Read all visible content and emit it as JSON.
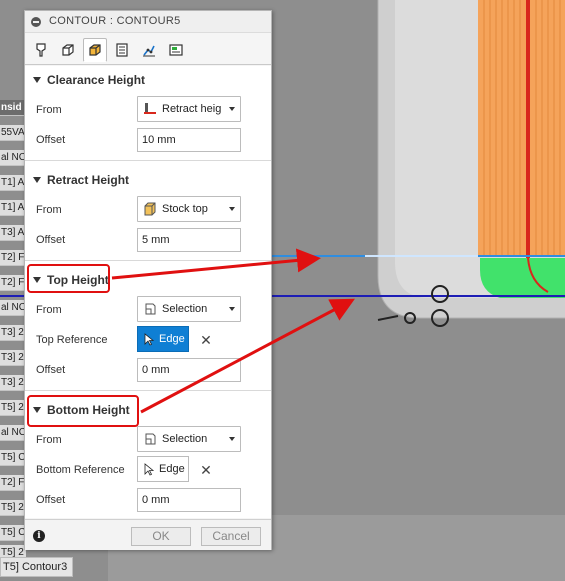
{
  "dialog": {
    "title": "CONTOUR : CONTOUR5",
    "tabs": [
      {
        "name": "tool-tab",
        "icon": "tool-icon"
      },
      {
        "name": "geometry-tab",
        "icon": "geometry-icon"
      },
      {
        "name": "heights-tab",
        "icon": "heights-icon",
        "active": true
      },
      {
        "name": "passes-tab",
        "icon": "passes-icon"
      },
      {
        "name": "linking-tab",
        "icon": "linking-icon"
      },
      {
        "name": "post-tab",
        "icon": "post-icon"
      }
    ],
    "sections": {
      "clearance": {
        "header": "Clearance Height",
        "from_label": "From",
        "from_value": "Retract heig",
        "offset_label": "Offset",
        "offset_value": "10 mm"
      },
      "retract": {
        "header": "Retract Height",
        "from_label": "From",
        "from_value": "Stock top",
        "offset_label": "Offset",
        "offset_value": "5 mm"
      },
      "top": {
        "header": "Top Height",
        "from_label": "From",
        "from_value": "Selection",
        "reference_label": "Top Reference",
        "reference_value": "Edge",
        "offset_label": "Offset",
        "offset_value": "0 mm"
      },
      "bottom": {
        "header": "Bottom Height",
        "from_label": "From",
        "from_value": "Selection",
        "reference_label": "Bottom Reference",
        "reference_value": "Edge",
        "offset_label": "Offset",
        "offset_value": "0 mm"
      }
    },
    "footer": {
      "ok_label": "OK",
      "cancel_label": "Cancel"
    }
  },
  "browser": {
    "items": [
      "nsid",
      "55VA",
      "al NC",
      "T1] A",
      "T1] A",
      "T3] A",
      "T2] F",
      "T2] F",
      "al NC",
      "T3] 2",
      "T3] 2",
      "T3] 2",
      "T5] 2",
      "al NC",
      "T5] C",
      "T2] F",
      "T5] 2",
      "T5] C",
      "T5] 2",
      "T5] 2"
    ],
    "bottom_item": "T5] Contour3"
  },
  "colors": {
    "accent": "#0f7fd4",
    "highlight": "#e01010",
    "toolpath_orange": "#f5a35a",
    "stock_green": "#41e26b",
    "top_line": "#2f8de0",
    "bottom_line": "#1d1db5"
  }
}
